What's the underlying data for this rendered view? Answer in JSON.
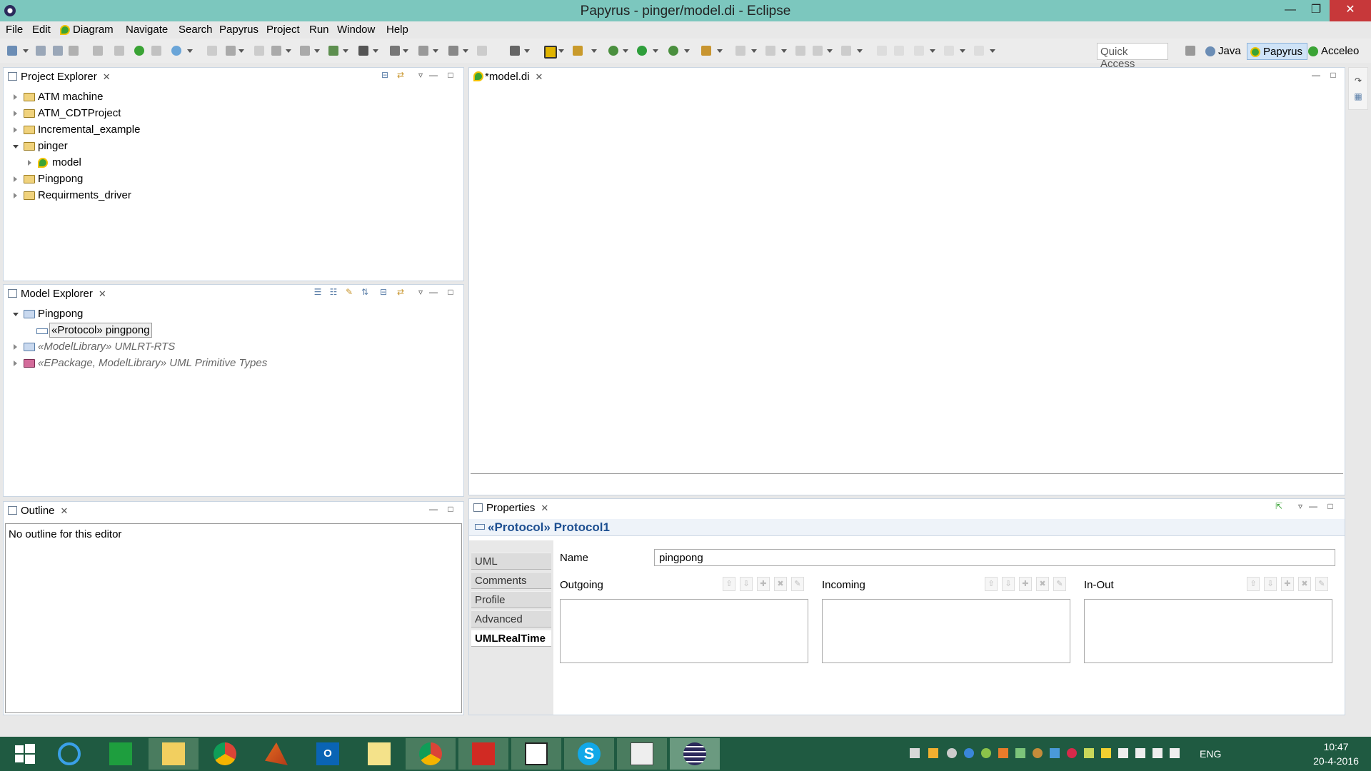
{
  "window": {
    "title": "Papyrus - pinger/model.di - Eclipse"
  },
  "menu": [
    "File",
    "Edit",
    "Diagram",
    "Navigate",
    "Search",
    "Papyrus",
    "Project",
    "Run",
    "Window",
    "Help"
  ],
  "toolbar": {
    "quick_access": "Quick Access",
    "perspectives": [
      "Java",
      "Papyrus",
      "Acceleo"
    ],
    "active_perspective": "Papyrus"
  },
  "project_explorer": {
    "title": "Project Explorer",
    "items": [
      {
        "label": "ATM machine",
        "expanded": false
      },
      {
        "label": "ATM_CDTProject",
        "expanded": false
      },
      {
        "label": "Incremental_example",
        "expanded": false
      },
      {
        "label": "pinger",
        "expanded": true
      },
      {
        "label": "model",
        "expanded": false,
        "child": true
      },
      {
        "label": "Pingpong",
        "expanded": false
      },
      {
        "label": "Requirments_driver",
        "expanded": false
      }
    ]
  },
  "model_explorer": {
    "title": "Model Explorer",
    "items": [
      {
        "label": "Pingpong",
        "expanded": true
      },
      {
        "label": "«Protocol» pingpong",
        "child": true,
        "selected": true
      },
      {
        "label": "«ModelLibrary» UMLRT-RTS",
        "italic": true
      },
      {
        "label": "«EPackage, ModelLibrary» UML Primitive Types",
        "italic": true
      }
    ]
  },
  "outline": {
    "title": "Outline",
    "message": "No outline for this editor"
  },
  "editor": {
    "tab_label": "*model.di"
  },
  "properties": {
    "title": "Properties",
    "header": "«Protocol» Protocol1",
    "tabs": [
      "UML",
      "Comments",
      "Profile",
      "Advanced",
      "UMLRealTime"
    ],
    "active_tab": "UMLRealTime",
    "name_label": "Name",
    "name_value": "pingpong",
    "lists": [
      {
        "label": "Outgoing"
      },
      {
        "label": "Incoming"
      },
      {
        "label": "In-Out"
      }
    ]
  },
  "taskbar": {
    "language": "ENG",
    "time": "10:47",
    "date": "20-4-2016"
  },
  "colors": {
    "titlebar": "#7cc7be",
    "close": "#c7383a",
    "taskbar": "#1f5a41",
    "selection_blue": "#1d4f91"
  }
}
